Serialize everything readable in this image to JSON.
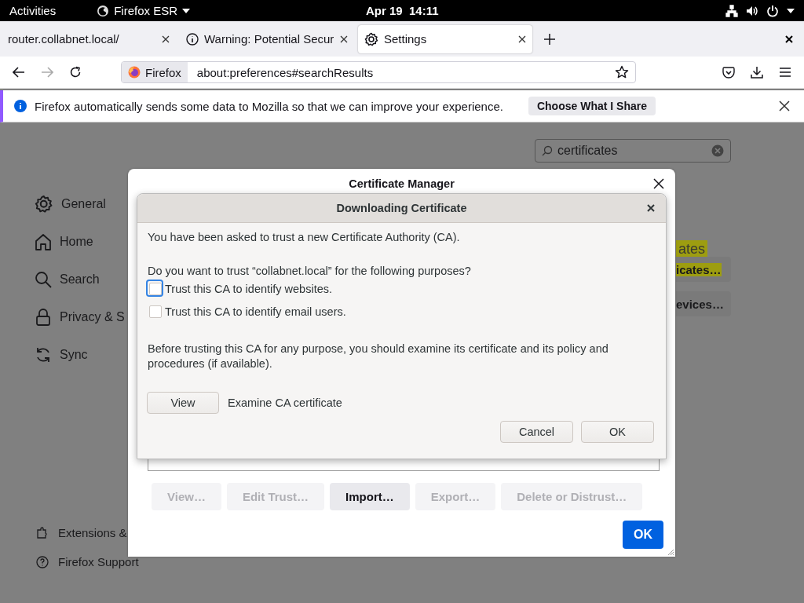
{
  "top_bar": {
    "activities": "Activities",
    "app_menu": "Firefox ESR",
    "clock": "Apr 19  14:11"
  },
  "tabs": [
    {
      "label": "router.collabnet.local/",
      "kind": "page",
      "selected": false
    },
    {
      "label": "Warning: Potential Secur",
      "kind": "info",
      "selected": false
    },
    {
      "label": "Settings",
      "kind": "settings",
      "selected": true
    }
  ],
  "address_bar": {
    "identity": "Firefox",
    "url": "about:preferences#searchResults"
  },
  "notification": {
    "message": "Firefox automatically sends some data to Mozilla so that we can improve your experience.",
    "button": "Choose What I Share"
  },
  "preferences": {
    "search": {
      "value": "certificates"
    },
    "sidebar": [
      {
        "label": "General",
        "kind": "general"
      },
      {
        "label": "Home",
        "kind": "home"
      },
      {
        "label": "Search",
        "kind": "search"
      },
      {
        "label": "Privacy & S",
        "kind": "privacy"
      },
      {
        "label": "Sync",
        "kind": "sync"
      }
    ],
    "footer_links": [
      {
        "label": "Extensions &",
        "kind": "extensions"
      },
      {
        "label": "Firefox Support",
        "kind": "support"
      }
    ],
    "result_highlight": "ates",
    "result_buttons": [
      "icates…",
      "evices…"
    ]
  },
  "certificate_manager": {
    "title": "Certificate Manager",
    "buttons": [
      {
        "label": "View…",
        "disabled": true
      },
      {
        "label": "Edit Trust…",
        "disabled": true
      },
      {
        "label": "Import…",
        "disabled": false
      },
      {
        "label": "Export…",
        "disabled": true
      },
      {
        "label": "Delete or Distrust…",
        "disabled": true
      }
    ],
    "ok": "OK"
  },
  "download_dialog": {
    "title": "Downloading Certificate",
    "intro": "You have been asked to trust a new Certificate Authority (CA).",
    "question": "Do you want to trust “collabnet.local” for the following purposes?",
    "options": [
      {
        "label": "Trust this CA to identify websites.",
        "checked": false,
        "focused": true
      },
      {
        "label": "Trust this CA to identify email users.",
        "checked": false,
        "focused": false
      }
    ],
    "advice": "Before trusting this CA for any purpose, you should examine its certificate and its policy and procedures (if available).",
    "view_button": "View",
    "view_label": "Examine CA certificate",
    "buttons": [
      "Cancel",
      "OK"
    ]
  }
}
